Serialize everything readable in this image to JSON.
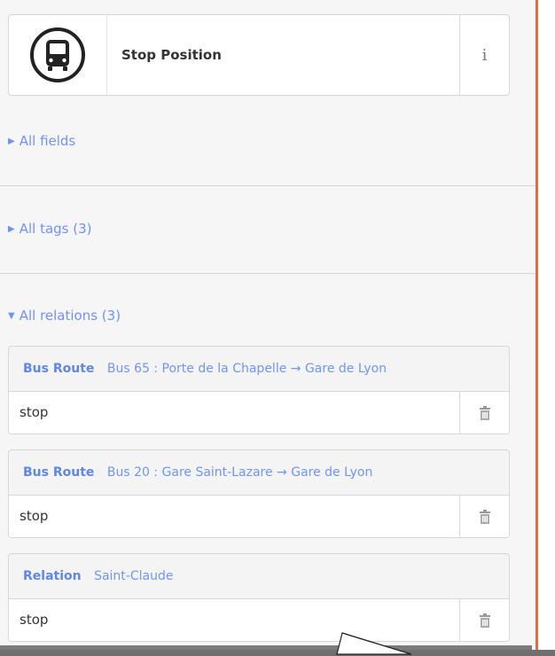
{
  "preset": {
    "name": "Stop Position",
    "icon": "bus-icon",
    "info_label": "i"
  },
  "sections": {
    "all_fields": "All fields",
    "all_tags": "All tags (3)",
    "all_relations": "All relations (3)"
  },
  "relations": [
    {
      "type": "Bus Route",
      "name": "Bus 65 : Porte de la Chapelle → Gare de Lyon",
      "role": "stop"
    },
    {
      "type": "Bus Route",
      "name": "Bus 20 : Gare Saint-Lazare → Gare de Lyon",
      "role": "stop"
    },
    {
      "type": "Relation",
      "name": "Saint-Claude",
      "role": "stop"
    }
  ],
  "colors": {
    "link": "#7092ff",
    "accent_edge": "#e06d3f"
  }
}
